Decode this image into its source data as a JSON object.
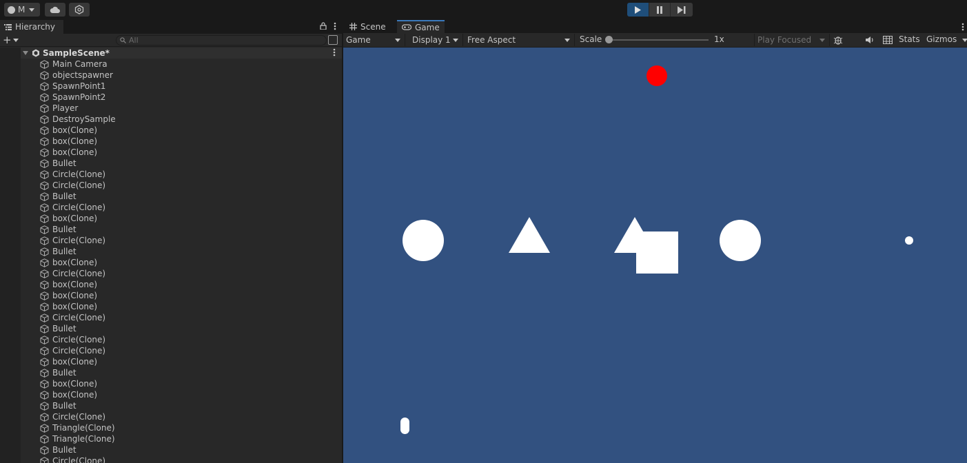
{
  "toolbar": {
    "account_label": "M",
    "icons": [
      "account-icon",
      "cloud-icon",
      "collab-icon"
    ],
    "play": {
      "play_active": true,
      "icons": [
        "play-icon",
        "pause-icon",
        "step-icon"
      ]
    }
  },
  "hierarchy": {
    "tab_label": "Hierarchy",
    "search_placeholder": "All",
    "scene_name": "SampleScene*",
    "items": [
      "Main Camera",
      "objectspawner",
      "SpawnPoint1",
      "SpawnPoint2",
      "Player",
      "DestroySample",
      "box(Clone)",
      "box(Clone)",
      "box(Clone)",
      "Bullet",
      "Circle(Clone)",
      "Circle(Clone)",
      "Bullet",
      "Circle(Clone)",
      "box(Clone)",
      "Bullet",
      "Circle(Clone)",
      "Bullet",
      "box(Clone)",
      "Circle(Clone)",
      "box(Clone)",
      "box(Clone)",
      "box(Clone)",
      "Circle(Clone)",
      "Bullet",
      "Circle(Clone)",
      "Circle(Clone)",
      "box(Clone)",
      "Bullet",
      "box(Clone)",
      "box(Clone)",
      "Bullet",
      "Circle(Clone)",
      "Triangle(Clone)",
      "Triangle(Clone)",
      "Bullet",
      "Circle(Clone)"
    ]
  },
  "game_view": {
    "tabs": [
      {
        "label": "Scene",
        "icon": "grid-icon"
      },
      {
        "label": "Game",
        "icon": "gamepad-icon"
      }
    ],
    "active_tab": "Game",
    "mode": "Game",
    "display": "Display 1",
    "aspect": "Free Aspect",
    "scale_label": "Scale",
    "scale_value": "1x",
    "play_focus": "Play Focused",
    "stats_label": "Stats",
    "gizmos_label": "Gizmos",
    "background_color": "#325180",
    "objects_color": "#ffffff",
    "player_color": "#ff0000"
  }
}
